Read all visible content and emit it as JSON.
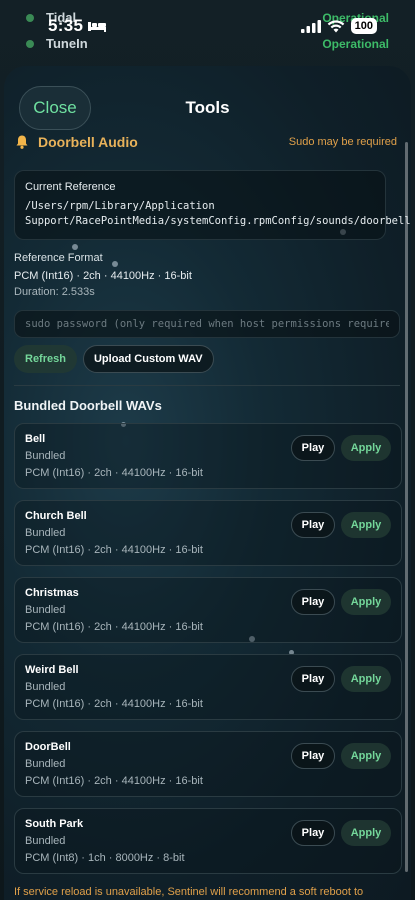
{
  "status_bar": {
    "time": "5:35",
    "battery": "100"
  },
  "background": {
    "rows": [
      {
        "name": "Tidal",
        "status": "Operational"
      },
      {
        "name": "TuneIn",
        "status": "Operational"
      }
    ]
  },
  "sheet": {
    "close_label": "Close",
    "title": "Tools"
  },
  "doorbell": {
    "section_title": "Doorbell Audio",
    "sudo_note": "Sudo may be required",
    "current_reference_label": "Current Reference",
    "current_reference_path": "/Users/rpm/Library/Application Support/RacePointMedia/systemConfig.rpmConfig/sounds/doorbell.wav",
    "reference_format_label": "Reference Format",
    "reference_format_value": "PCM (Int16) · 2ch · 44100Hz · 16-bit",
    "duration": "Duration: 2.533s",
    "sudo_placeholder": "sudo password (only required when host permissions require it)",
    "refresh_label": "Refresh",
    "upload_label": "Upload Custom WAV",
    "bundled_title": "Bundled Doorbell WAVs",
    "play_label": "Play",
    "apply_label": "Apply",
    "wavs": [
      {
        "name": "Bell",
        "source": "Bundled",
        "format": "PCM (Int16) · 2ch · 44100Hz · 16-bit"
      },
      {
        "name": "Church Bell",
        "source": "Bundled",
        "format": "PCM (Int16) · 2ch · 44100Hz · 16-bit"
      },
      {
        "name": "Christmas",
        "source": "Bundled",
        "format": "PCM (Int16) · 2ch · 44100Hz · 16-bit"
      },
      {
        "name": "Weird Bell",
        "source": "Bundled",
        "format": "PCM (Int16) · 2ch · 44100Hz · 16-bit"
      },
      {
        "name": "DoorBell",
        "source": "Bundled",
        "format": "PCM (Int16) · 2ch · 44100Hz · 16-bit"
      },
      {
        "name": "South Park",
        "source": "Bundled",
        "format": "PCM (Int8) · 1ch · 8000Hz · 8-bit"
      }
    ],
    "footer_note": "If service reload is unavailable, Sentinel will recommend a soft reboot to activate the new doorbell sound."
  },
  "colors": {
    "accent_green": "#74d79a",
    "warning_orange": "#e0a04a",
    "section_gold": "#e8b25a"
  }
}
